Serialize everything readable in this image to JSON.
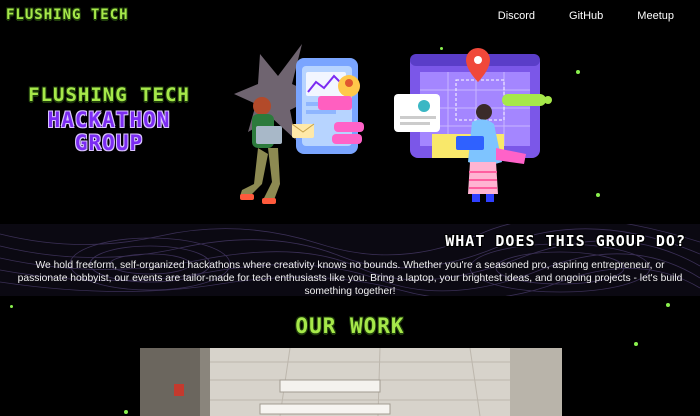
{
  "header": {
    "logo": "FLUSHING TECH",
    "nav": [
      "Discord",
      "GitHub",
      "Meetup"
    ]
  },
  "hero": {
    "title_line1": "FLUSHING TECH",
    "title_line2": "HACKATHON",
    "title_line3": "GROUP"
  },
  "about": {
    "heading": "WHAT DOES THIS GROUP DO?",
    "body": "We hold freeform, self-organized hackathons where creativity knows no bounds. Whether you're a seasoned pro, aspiring entrepreneur, or passionate hobbyist, our events are tailor-made for tech enthusiasts like you. Bring a laptop, your brightest ideas, and ongoing projects - let's build something together!"
  },
  "work": {
    "heading": "OUR WORK"
  },
  "colors": {
    "background": "#000000",
    "accent_lime": "#a6e84a",
    "accent_purple": "#7b2cf2",
    "dot_green": "#8af04e"
  },
  "icons": [
    "person-with-laptop-illustration",
    "location-pin-illustration"
  ]
}
